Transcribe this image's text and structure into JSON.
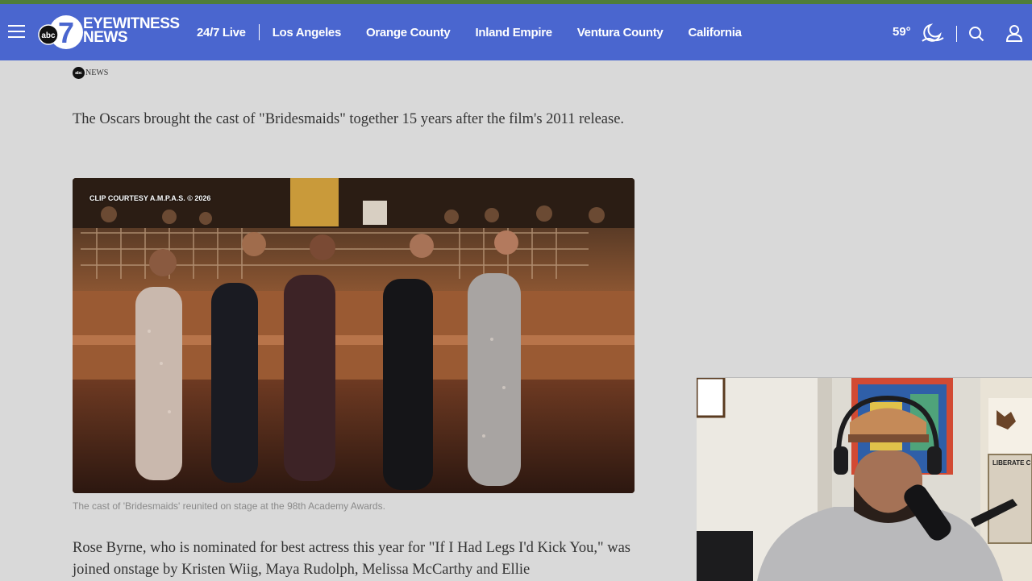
{
  "header": {
    "logo_text": "EYEWITNESS NEWS",
    "logo_badge": "abc",
    "logo_number": "7",
    "nav": [
      "24/7 Live",
      "Los Angeles",
      "Orange County",
      "Inland Empire",
      "Ventura County",
      "California"
    ],
    "weather_temp": "59°",
    "icons": [
      "menu-icon",
      "weather-icon",
      "search-icon",
      "user-icon"
    ]
  },
  "article": {
    "source_badge": "abc",
    "source_label": "NEWS",
    "para1": "The Oscars brought the cast of \"Bridesmaids\" together 15 years after the film's 2011 release.",
    "video_credit": "CLIP COURTESY A.M.P.A.S. © 2026",
    "caption": "The cast of 'Bridesmaids' reunited on stage at the 98th Academy Awards.",
    "para2": "Rose Byrne, who is nominated for best actress this year for \"If I Had Legs I'd Kick You,\" was joined onstage by Kristen Wiig, Maya Rudolph, Melissa McCarthy and Ellie"
  },
  "webcam": {
    "poster_text": "LIBERATE C"
  },
  "colors": {
    "nav_bg": "#4a66cf",
    "page_bg": "#d9d9d9",
    "top_strip": "#4f7d3a"
  }
}
